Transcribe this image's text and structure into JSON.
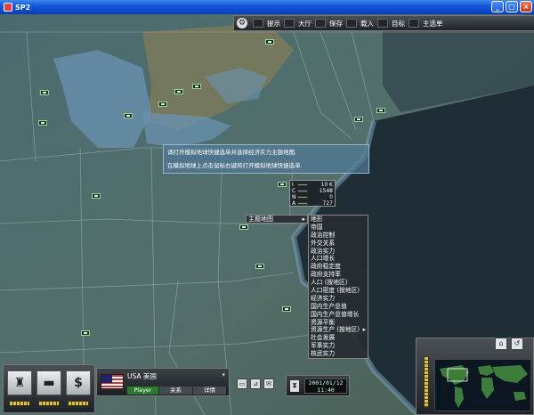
{
  "window": {
    "title": "SP2"
  },
  "toolbar": {
    "items": [
      "提示",
      "大厅",
      "保存",
      "载入",
      "目标",
      "主选单"
    ]
  },
  "tooltip": {
    "line1": "请打开模拟地球快捷选单并选择经济实力主题地图.",
    "line2": "在模拟地球上点击鼠标右键将打开模拟地球快捷选单."
  },
  "stats": {
    "rows": [
      {
        "key": "I",
        "value": "10 K"
      },
      {
        "key": "C",
        "value": "1548"
      },
      {
        "key": "N",
        "value": "0"
      },
      {
        "key": "A",
        "value": "727"
      }
    ]
  },
  "context_menu": {
    "head": "主题地图",
    "items": [
      "地形",
      "帝国",
      "政治控制",
      "外交关系",
      "政治实力",
      "人口增长",
      "政府稳定度",
      "政府支持率",
      "人口 (按地区)",
      "人口密度 (按地区)",
      "经济实力",
      "国内生产总值",
      "国内生产总值增长",
      "资源平衡",
      "资源生产 (按地区)",
      "社会发展",
      "军事实力",
      "核武实力"
    ],
    "submenu_index": 14
  },
  "country": {
    "name": "USA 美国",
    "player": "Player",
    "relations": "关系",
    "details": "详情"
  },
  "datetime": {
    "date": "2001/01/12",
    "time": "11:40"
  },
  "icons": {
    "panel_buttons": [
      "politics-icon",
      "military-icon",
      "economy-icon"
    ],
    "mini_buttons": [
      "monitor-icon",
      "chart-icon",
      "mail-icon"
    ]
  },
  "colors": {
    "titlebar": "#0b47c6",
    "menu_bg": "#282d32",
    "player_green": "#2d7a2d"
  }
}
